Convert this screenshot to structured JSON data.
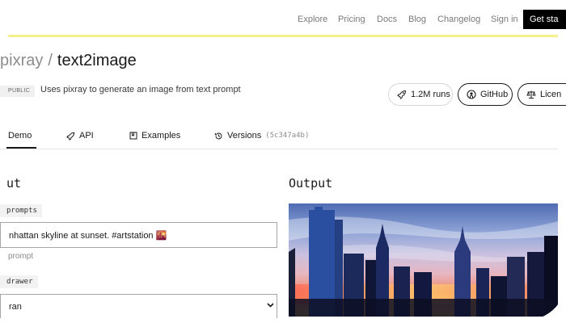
{
  "nav": {
    "links": [
      "Explore",
      "Pricing",
      "Docs",
      "Blog",
      "Changelog",
      "Sign in"
    ],
    "get_started": "Get sta"
  },
  "header": {
    "owner": "pixray",
    "separator": "/",
    "model": "text2image",
    "badge": "PUBLIC",
    "description": "Uses pixray to generate an image from text prompt"
  },
  "actions": {
    "runs": "1.2M runs",
    "github": "GitHub",
    "license": "Licen"
  },
  "tabs": {
    "demo": "Demo",
    "api": "API",
    "examples": "Examples",
    "versions": "Versions",
    "version_hash": "(5c347a4b)"
  },
  "input": {
    "heading": "ut",
    "prompts_label": "prompts",
    "prompts_value": "nhattan skyline at sunset. #artstation 🌇",
    "prompts_hint": "prompt",
    "drawer_label": "drawer",
    "drawer_value": "ran"
  },
  "output": {
    "heading": "Output"
  },
  "colors": {
    "accent_bar": "#f7ee8c",
    "button_dark": "#000000"
  }
}
